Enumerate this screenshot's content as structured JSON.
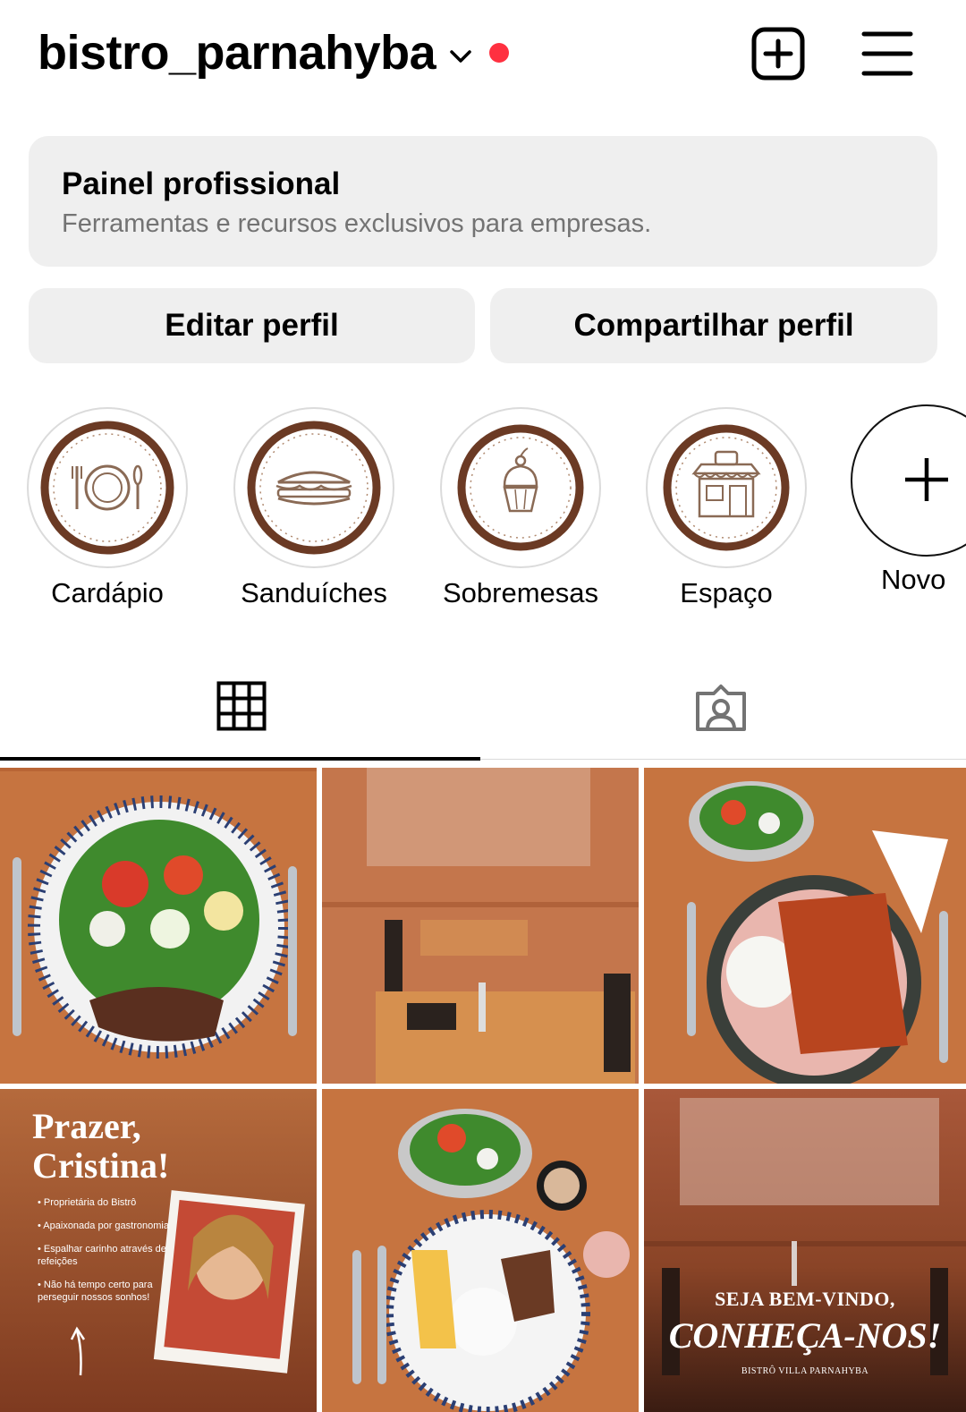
{
  "header": {
    "username": "bistro_parnahyba",
    "accent_dot_color": "#ff3040",
    "icons": {
      "account_switch": "chevron-down-icon",
      "create": "add-square-icon",
      "menu": "hamburger-menu-icon"
    }
  },
  "professional_panel": {
    "title": "Painel profissional",
    "subtitle": "Ferramentas e recursos exclusivos para empresas."
  },
  "actions": {
    "edit_label": "Editar perfil",
    "share_label": "Compartilhar perfil"
  },
  "highlights": [
    {
      "label": "Cardápio",
      "icon": "plate-cutlery-icon"
    },
    {
      "label": "Sanduíches",
      "icon": "sandwich-icon"
    },
    {
      "label": "Sobremesas",
      "icon": "cupcake-icon"
    },
    {
      "label": "Espaço",
      "icon": "storefront-icon"
    }
  ],
  "new_highlight": {
    "label": "Novo",
    "icon": "plus-icon"
  },
  "tabs": [
    {
      "name": "posts-grid",
      "icon": "grid-icon",
      "active": true
    },
    {
      "name": "tagged",
      "icon": "tagged-person-icon",
      "active": false
    }
  ],
  "posts": {
    "p4": {
      "title_line1": "Prazer,",
      "title_line2": "Cristina!",
      "bullets": [
        "• Proprietária do Bistrô",
        "• Apaixonada por gastronomia",
        "• Espalhar carinho através de refeições",
        "• Não há tempo certo para perseguir nossos sonhos!"
      ]
    },
    "p6": {
      "line1": "SEJA BEM-VINDO,",
      "line2": "CONHEÇA-NOS!",
      "line3": "BISTRÔ VILLA PARNAHYBA"
    }
  },
  "colors": {
    "highlight_brown": "#6b3a24",
    "panel_bg": "#efefef",
    "wood": "#c7733f",
    "wall": "#b9683f"
  }
}
